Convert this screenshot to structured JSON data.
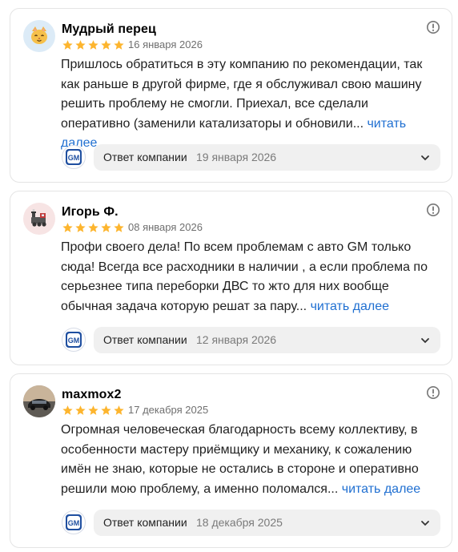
{
  "reviews": [
    {
      "author": "Мудрый перец",
      "rating": 5,
      "date": "16 января 2026",
      "text": "Пришлось обратиться в эту компанию по рекомендации, так как раньше в другой фирме, где я обслуживал свою машину решить проблему не смогли. Приехал, все сделали оперативно (заменили катализаторы и обновили...",
      "more": "читать далее",
      "reply_label": "Ответ компании",
      "reply_date": "19 января 2026",
      "avatar_icon": "cat-emoji-icon"
    },
    {
      "author": "Игорь Ф.",
      "rating": 5,
      "date": "08 января 2026",
      "text": "Профи своего дела! По всем проблемам с авто GM только сюда! Всегда все расходники в наличии , а если проблема по серьезнее типа переборки ДВС то жто для них вообще обычная задача которую решат за пару...",
      "more": "читать далее",
      "reply_label": "Ответ компании",
      "reply_date": "12 января 2026",
      "avatar_icon": "locomotive-icon"
    },
    {
      "author": "maxmox2",
      "rating": 5,
      "date": "17 декабря 2025",
      "text": "Огромная человеческая благодарность всему коллективу, в особенности мастеру приёмщику и механику, к сожалению имён не знаю, которые не остались в стороне и оперативно решили мою проблему, а именно поломался...",
      "more": "читать далее",
      "reply_label": "Ответ компании",
      "reply_date": "18 декабря 2025",
      "avatar_icon": "car-photo-icon"
    }
  ],
  "company_logo_text": "GM",
  "colors": {
    "star": "#fdb52e",
    "link": "#1f6fd1",
    "reply_bg": "#f0f0f0",
    "logo_blue": "#1f4fa0"
  }
}
